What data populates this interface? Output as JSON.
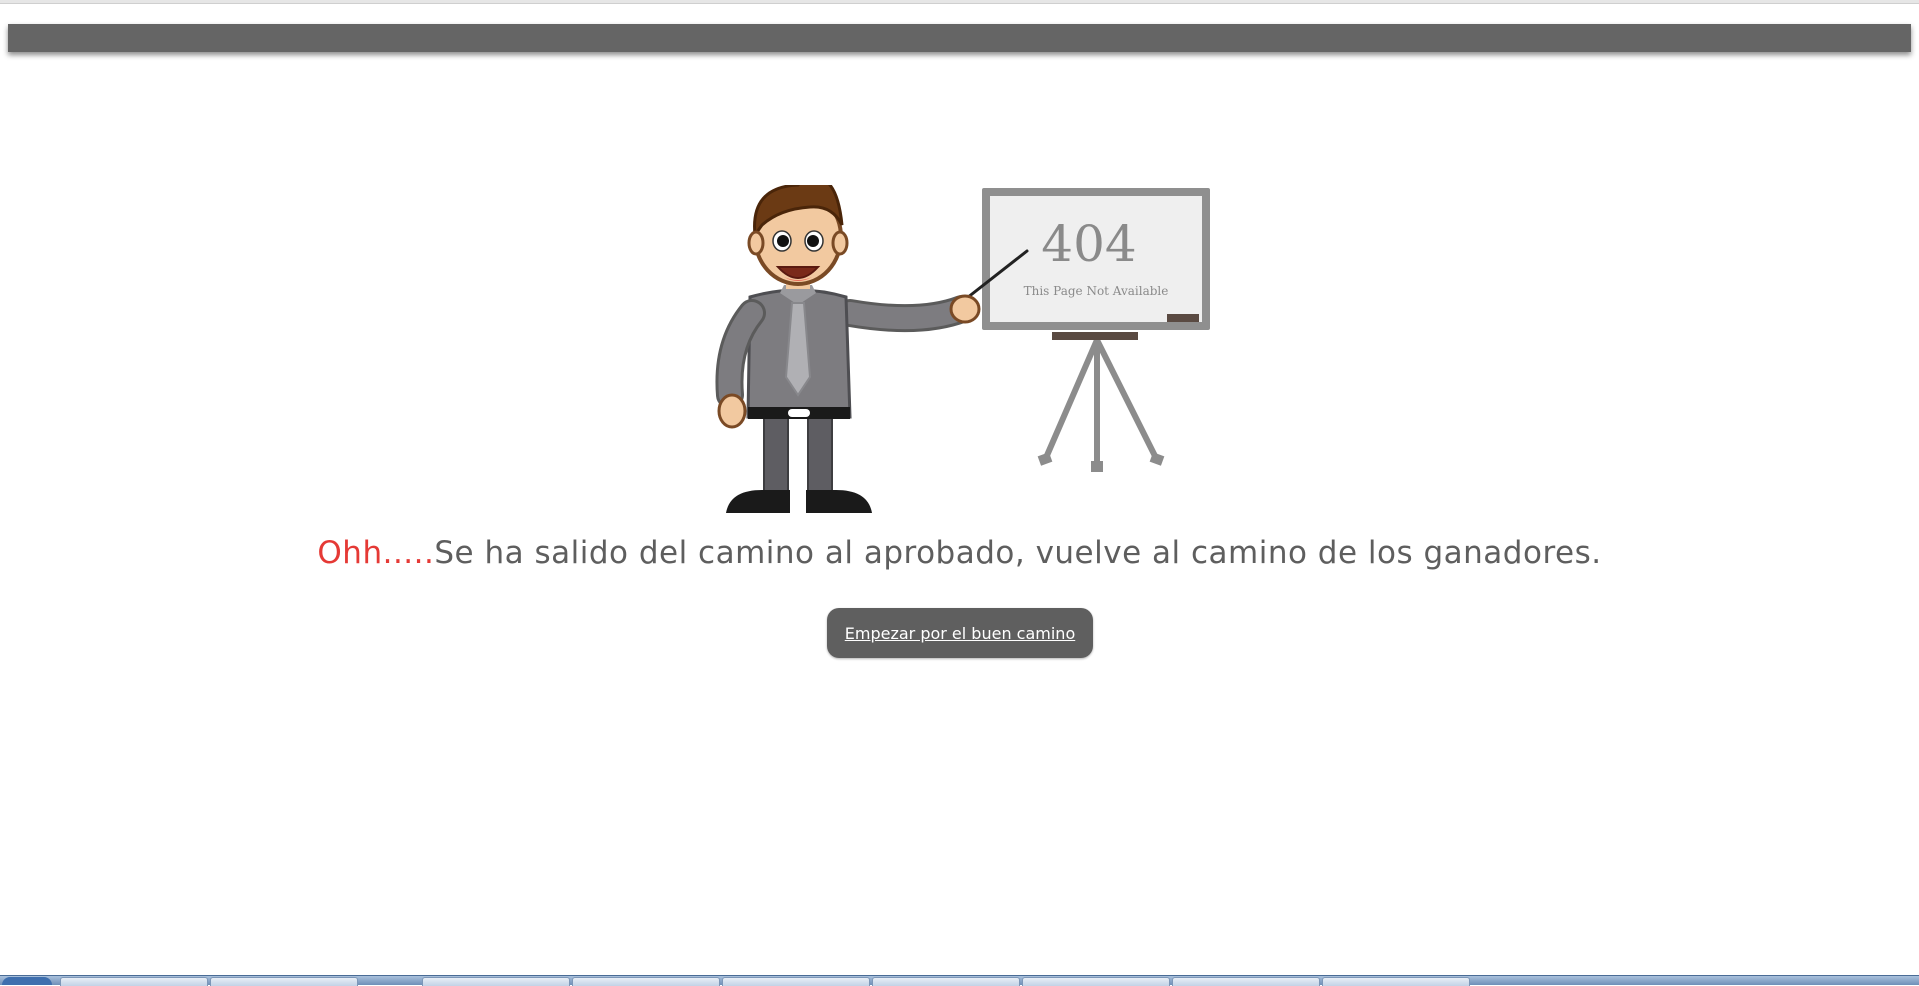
{
  "error_code": "404",
  "board_caption": "This Page Not Available",
  "message": {
    "accent": "Ohh.....",
    "body": "Se ha salido del camino al aprobado, vuelve al camino de los ganadores."
  },
  "cta_label": "Empezar por el buen camino",
  "colors": {
    "accent": "#e53935",
    "text": "#5e5e5e",
    "header_bar": "#656565",
    "button_bg": "#5f5f5f"
  },
  "icons": [
    "presenter-illustration",
    "whiteboard-easel-icon"
  ]
}
